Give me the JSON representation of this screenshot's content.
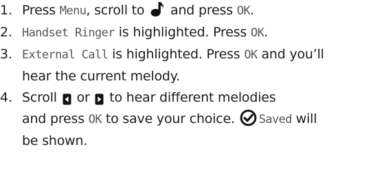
{
  "steps": [
    {
      "number": "1.",
      "t1": "Press ",
      "k1": "Menu",
      "t2": ", scroll to ",
      "icon": "music-note-icon",
      "t3": " and press ",
      "k2": "OK",
      "t4": "."
    },
    {
      "number": "2.",
      "k1": "Handset Ringer",
      "t1": " is highlighted. Press ",
      "k2": "OK",
      "t2": "."
    },
    {
      "number": "3.",
      "k1": "External Call",
      "t1": " is highlighted. Press ",
      "k2": "OK",
      "t2": " and you’ll",
      "line2": "hear the current melody."
    },
    {
      "number": "4.",
      "t1": "Scroll ",
      "left_icon": "left-arrow-key-icon",
      "t2": " or ",
      "right_icon": "right-arrow-key-icon",
      "t3": " to hear different melodies",
      "l2a": "and press ",
      "k1": "OK",
      "l2b": " to save your choice. ",
      "check_icon": "check-circle-icon",
      "k2": "Saved",
      "l2c": " will",
      "line3": "be shown."
    }
  ]
}
